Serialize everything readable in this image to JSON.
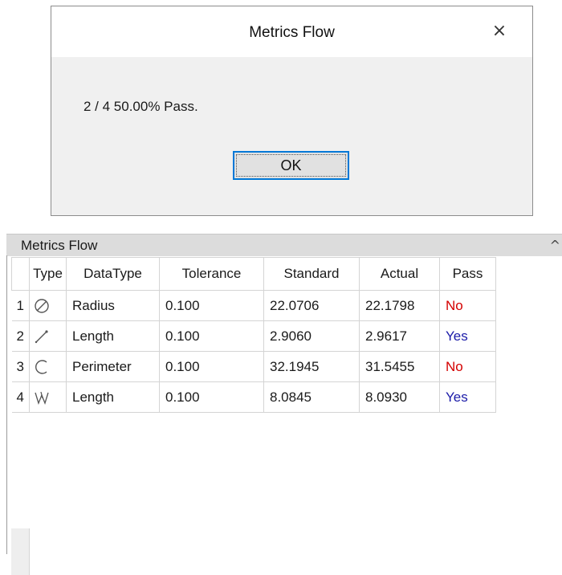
{
  "dialog": {
    "title": "Metrics Flow",
    "close_glyph": "×",
    "message": "2 / 4  50.00% Pass.",
    "ok_label": "OK"
  },
  "panel": {
    "title": "Metrics Flow",
    "collapse_glyph": "^"
  },
  "table": {
    "headers": {
      "type": "Type",
      "datatype": "DataType",
      "tolerance": "Tolerance",
      "standard": "Standard",
      "actual": "Actual",
      "pass": "Pass"
    },
    "rows": [
      {
        "index": "1",
        "icon": "diameter-icon",
        "datatype": "Radius",
        "tolerance": "0.100",
        "standard": "22.0706",
        "actual": "22.1798",
        "pass": "No"
      },
      {
        "index": "2",
        "icon": "line-length-icon",
        "datatype": "Length",
        "tolerance": "0.100",
        "standard": "2.9060",
        "actual": "2.9617",
        "pass": "Yes"
      },
      {
        "index": "3",
        "icon": "arc-icon",
        "datatype": "Perimeter",
        "tolerance": "0.100",
        "standard": "32.1945",
        "actual": "31.5455",
        "pass": "No"
      },
      {
        "index": "4",
        "icon": "polyline-icon",
        "datatype": "Length",
        "tolerance": "0.100",
        "standard": "8.0845",
        "actual": "8.0930",
        "pass": "Yes"
      }
    ]
  },
  "colors": {
    "pass_no": "#d40000",
    "pass_yes": "#1a1aa8",
    "ok_border": "#0078d7"
  }
}
